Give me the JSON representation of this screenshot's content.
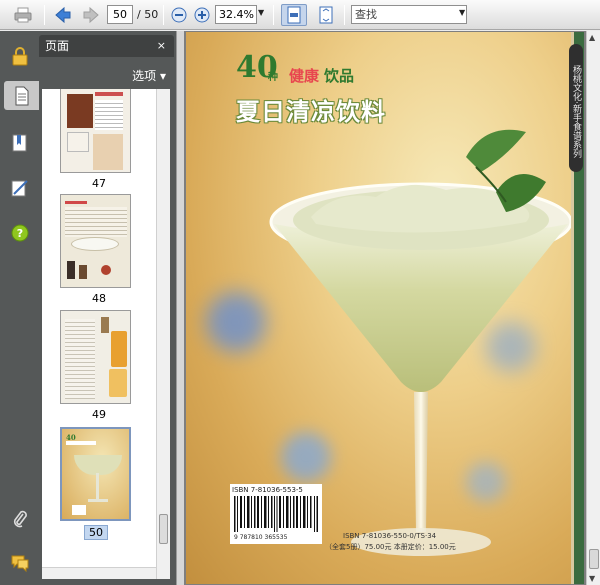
{
  "toolbar": {
    "page_current": "50",
    "page_total": "/ 50",
    "zoom": "32.4%",
    "search_placeholder": "查找"
  },
  "rail": {
    "icons": [
      "lock-icon",
      "pages-icon",
      "bookmarks-icon",
      "signatures-icon",
      "help-icon",
      "attachments-icon",
      "comments-icon"
    ]
  },
  "panel": {
    "title": "页面",
    "close": "×",
    "options": "选项 ▾",
    "thumbnails": [
      {
        "label": "47"
      },
      {
        "label": "48"
      },
      {
        "label": "49"
      },
      {
        "label": "50"
      }
    ]
  },
  "document": {
    "cover_number": "40",
    "cover_kind": "种",
    "cover_subtitle_red": "健康",
    "cover_subtitle_green": "饮品",
    "cover_title": "夏日清凉饮料",
    "series_tab": "杨桃文化·新手食谱系列",
    "isbn_top": "ISBN 7-81036-553-5",
    "isbn_bottom": "9 787810 365535",
    "price_line1": "ISBN 7-81036-550-0/TS·34",
    "price_line2": "（全套5册）75.00元 本册定价：15.00元"
  },
  "colors": {
    "toolbar_bg": "#dcdcdc",
    "rail_bg": "#555858",
    "panel_header_bg": "#3f4141",
    "selection_blue": "#c3d7f0",
    "cover_green": "#2f7a2f",
    "cover_red": "#e8464f"
  }
}
